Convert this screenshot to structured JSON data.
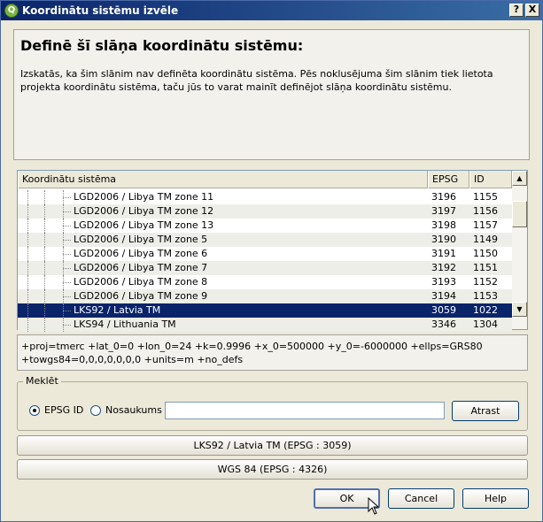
{
  "window": {
    "title": "Koordinātu sistēmu izvēle",
    "help_glyph": "?",
    "close_glyph": "X",
    "app_icon_glyph": "Q"
  },
  "info": {
    "heading": "Definē šī slāņa koordinātu sistēmu:",
    "description": "Izskatās, ka šim slānim nav definēta koordinātu sistēma. Pēs noklusējuma šim slānim tiek lietota projekta koordinātu sistēma, taču jūs to varat mainīt definējot slāņa koordinātu sistēmu."
  },
  "tree": {
    "columns": [
      "Koordinātu sistēma",
      "EPSG",
      "ID"
    ],
    "rows": [
      {
        "name": "LGD2006 / Libya TM zone 11",
        "epsg": "3196",
        "id": "1155"
      },
      {
        "name": "LGD2006 / Libya TM zone 12",
        "epsg": "3197",
        "id": "1156"
      },
      {
        "name": "LGD2006 / Libya TM zone 13",
        "epsg": "3198",
        "id": "1157"
      },
      {
        "name": "LGD2006 / Libya TM zone 5",
        "epsg": "3190",
        "id": "1149"
      },
      {
        "name": "LGD2006 / Libya TM zone 6",
        "epsg": "3191",
        "id": "1150"
      },
      {
        "name": "LGD2006 / Libya TM zone 7",
        "epsg": "3192",
        "id": "1151"
      },
      {
        "name": "LGD2006 / Libya TM zone 8",
        "epsg": "3193",
        "id": "1152"
      },
      {
        "name": "LGD2006 / Libya TM zone 9",
        "epsg": "3194",
        "id": "1153"
      },
      {
        "name": "LKS92 / Latvia TM",
        "epsg": "3059",
        "id": "1022"
      },
      {
        "name": "LKS94 / Lithuania TM",
        "epsg": "3346",
        "id": "1304"
      }
    ],
    "selected_index": 8,
    "scroll_up_glyph": "▲",
    "scroll_down_glyph": "▼"
  },
  "projection": {
    "line1": "+proj=tmerc +lat_0=0 +lon_0=24 +k=0.9996 +x_0=500000 +y_0=-6000000 +ellps=GRS80",
    "line2": "+towgs84=0,0,0,0,0,0,0 +units=m +no_defs"
  },
  "search": {
    "group_label": "Meklēt",
    "option_epsg": "EPSG ID",
    "option_name": "Nosaukums",
    "selected_option": "EPSG ID",
    "input_value": "",
    "find_button": "Atrast"
  },
  "recent": [
    "LKS92 / Latvia TM (EPSG : 3059)",
    "WGS 84 (EPSG : 4326)"
  ],
  "buttons": {
    "ok": "OK",
    "cancel": "Cancel",
    "help": "Help"
  }
}
